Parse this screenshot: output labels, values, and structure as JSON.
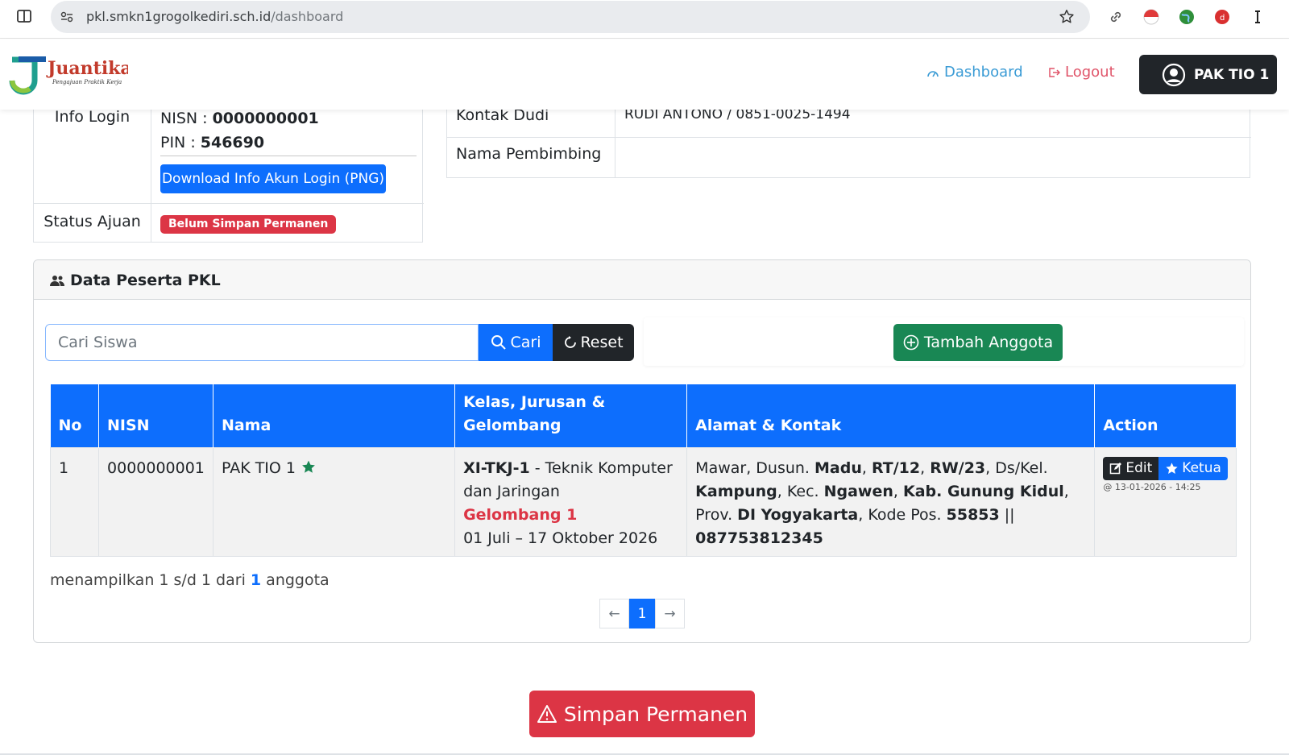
{
  "browser": {
    "url_host": "pkl.smkn1grogolkediri.sch.id",
    "url_path": "/dashboard"
  },
  "navbar": {
    "logo_text": "Juantika",
    "logo_tagline": "Pengajuan Praktik Kerja",
    "dashboard_label": "Dashboard",
    "logout_label": "Logout",
    "user_label": "PAK TIO 1"
  },
  "info_login": {
    "label": "Info Login",
    "nisn_label": "NISN : ",
    "nisn_value": "0000000001",
    "pin_label": "PIN : ",
    "pin_value": "546690",
    "download_button": "Download Info Akun Login (PNG)",
    "status_label": "Status Ajuan",
    "status_badge": "Belum Simpan Permanen"
  },
  "dudi_info": {
    "kontak_label": "Kontak Dudi",
    "kontak_value": "RUDI ANTONO / 0851-0025-1494",
    "pembimbing_label": "Nama Pembimbing",
    "pembimbing_value": ""
  },
  "peserta": {
    "title": "Data Peserta PKL",
    "search_placeholder": "Cari Siswa",
    "search_value": "",
    "cari_button": "Cari",
    "reset_button": "Reset",
    "tambah_button": "Tambah Anggota",
    "columns": [
      "No",
      "NISN",
      "Nama",
      "Kelas, Jurusan & Gelombang",
      "Alamat & Kontak",
      "Action"
    ],
    "rows": [
      {
        "no": "1",
        "nisn": "0000000001",
        "nama": "PAK TIO 1",
        "kelas": "XI-TKJ-1",
        "jurusan": " - Teknik Komputer dan Jaringan",
        "gelombang": "Gelombang 1",
        "periode": "01 Juli – 17 Oktober 2026",
        "alamat": {
          "jalan": "Mawar, Dusun. ",
          "dusun": "Madu",
          "rt": "RT/12",
          "rw": "RW/23",
          "desa_label": ", Ds/Kel. ",
          "desa": "Kampung",
          "kec_label": ", Kec. ",
          "kec": "Ngawen",
          "kab_label": "Kab. Gunung Kidul",
          "prov_label": ", Prov. ",
          "prov": "DI Yogyakarta",
          "kodepos_label": ", Kode Pos. ",
          "kodepos": "55853",
          "sep": " || ",
          "telp": "087753812345"
        },
        "edit_label": "Edit",
        "ketua_label": "Ketua",
        "timestamp": "@ 13-01-2026 - 14:25"
      }
    ],
    "summary_prefix": "menampilkan 1 s/d 1 dari ",
    "summary_total": "1",
    "summary_suffix": " anggota",
    "pagination": {
      "prev": "←",
      "current": "1",
      "next": "→"
    }
  },
  "simpan_button": "Simpan Permanen",
  "colors": {
    "primary": "#0d6efd",
    "danger": "#dc3545",
    "success": "#198754",
    "dark": "#212529",
    "dashboard_link": "#3a9bd5",
    "logout_link": "#e0556a"
  }
}
